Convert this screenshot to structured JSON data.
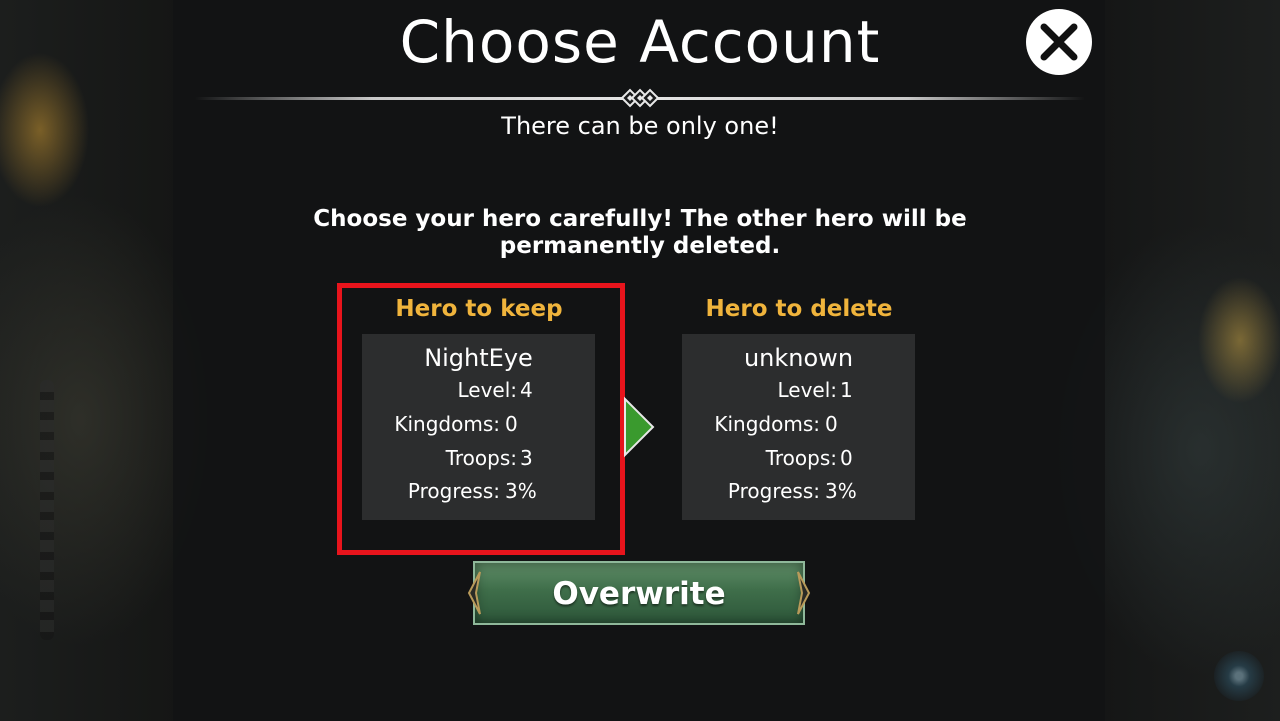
{
  "dialog": {
    "title": "Choose Account",
    "subtitle": "There can be only one!",
    "warning": "Choose your hero carefully! The other hero will be permanently deleted.",
    "close_icon": "close-icon"
  },
  "keep": {
    "label": "Hero to keep",
    "name": "NightEye",
    "stats": [
      {
        "key": "Level:",
        "value": "4"
      },
      {
        "key": "Kingdoms:",
        "value": "0"
      },
      {
        "key": "Troops:",
        "value": "3"
      },
      {
        "key": "Progress:",
        "value": "3%"
      }
    ]
  },
  "delete": {
    "label": "Hero to delete",
    "name": "unknown",
    "stats": [
      {
        "key": "Level:",
        "value": "1"
      },
      {
        "key": "Kingdoms:",
        "value": "0"
      },
      {
        "key": "Troops:",
        "value": "0"
      },
      {
        "key": "Progress:",
        "value": "3%"
      }
    ]
  },
  "arrow_icon": "arrow-right-icon",
  "overwrite_button": "Overwrite",
  "colors": {
    "label_gold": "#f0b43c",
    "highlight_red": "#e8141c",
    "arrow_green": "#3a9a2e",
    "button_green": "#3f6e4a"
  }
}
